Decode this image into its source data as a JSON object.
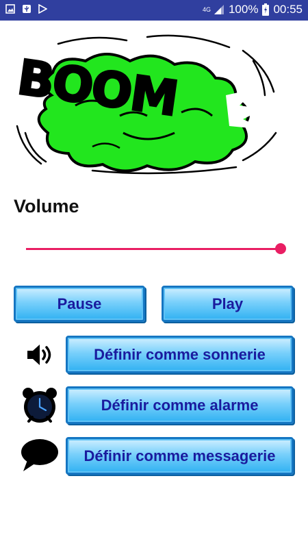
{
  "status_bar": {
    "network": "4G",
    "battery": "100%",
    "time": "00:55",
    "icons": [
      "gallery-icon",
      "usb-icon",
      "play-store-icon",
      "signal-icon",
      "battery-charging-icon"
    ]
  },
  "banner": {
    "text": "BOOM",
    "colors": {
      "cloud": "#22e61e",
      "outline": "#000000"
    }
  },
  "volume": {
    "label": "Volume",
    "level": 1.0,
    "color": "#e91e63"
  },
  "controls": {
    "pause_label": "Pause",
    "play_label": "Play"
  },
  "actions": {
    "ringtone_label": "Définir comme sonnerie",
    "alarm_label": "Définir comme alarme",
    "message_label": "Définir comme messagerie"
  },
  "colors": {
    "status_bar": "#303f9f",
    "button_text": "#1a1b9e",
    "button_border": "#1576c2",
    "button_fill": "#79d0fb"
  }
}
